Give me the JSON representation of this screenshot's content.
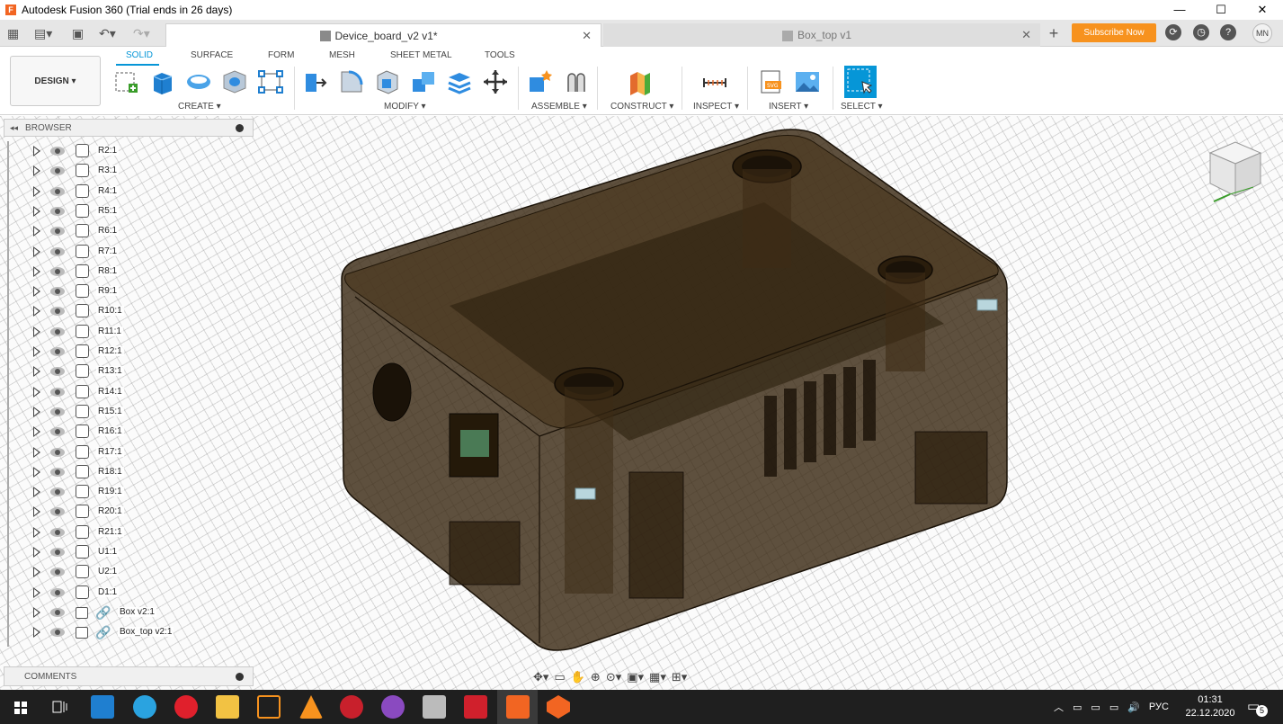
{
  "window": {
    "title": "Autodesk Fusion 360 (Trial ends in 26 days)",
    "minimize": "—",
    "maximize": "☐",
    "close": "✕"
  },
  "tabs": [
    {
      "label": "Device_board_v2 v1*",
      "close": "✕"
    },
    {
      "label": "Box_top v1",
      "close": "✕"
    }
  ],
  "header": {
    "new_tab": "+",
    "subscribe": "Subscribe Now",
    "avatar": "MN"
  },
  "ribbon": {
    "workspace": "DESIGN ▾",
    "tabs": [
      "SOLID",
      "SURFACE",
      "FORM",
      "MESH",
      "SHEET METAL",
      "TOOLS"
    ],
    "groups": [
      "CREATE ▾",
      "MODIFY ▾",
      "ASSEMBLE ▾",
      "CONSTRUCT ▾",
      "INSPECT ▾",
      "INSERT ▾",
      "SELECT ▾"
    ]
  },
  "browser": {
    "title": "BROWSER",
    "items": [
      "R2:1",
      "R3:1",
      "R4:1",
      "R5:1",
      "R6:1",
      "R7:1",
      "R8:1",
      "R9:1",
      "R10:1",
      "R11:1",
      "R12:1",
      "R13:1",
      "R14:1",
      "R15:1",
      "R16:1",
      "R17:1",
      "R18:1",
      "R19:1",
      "R20:1",
      "R21:1",
      "U1:1",
      "U2:1",
      "D1:1"
    ],
    "linked_items": [
      "Box v2:1",
      "Box_top v2:1"
    ]
  },
  "comments": {
    "title": "COMMENTS"
  },
  "taskbar": {
    "lang": "РУС",
    "time": "01:31",
    "date": "22.12.2020",
    "notifications": "5"
  },
  "colors": {
    "accent": "#0696d7",
    "subscribe": "#f7921e",
    "model": "#3a2a14"
  }
}
